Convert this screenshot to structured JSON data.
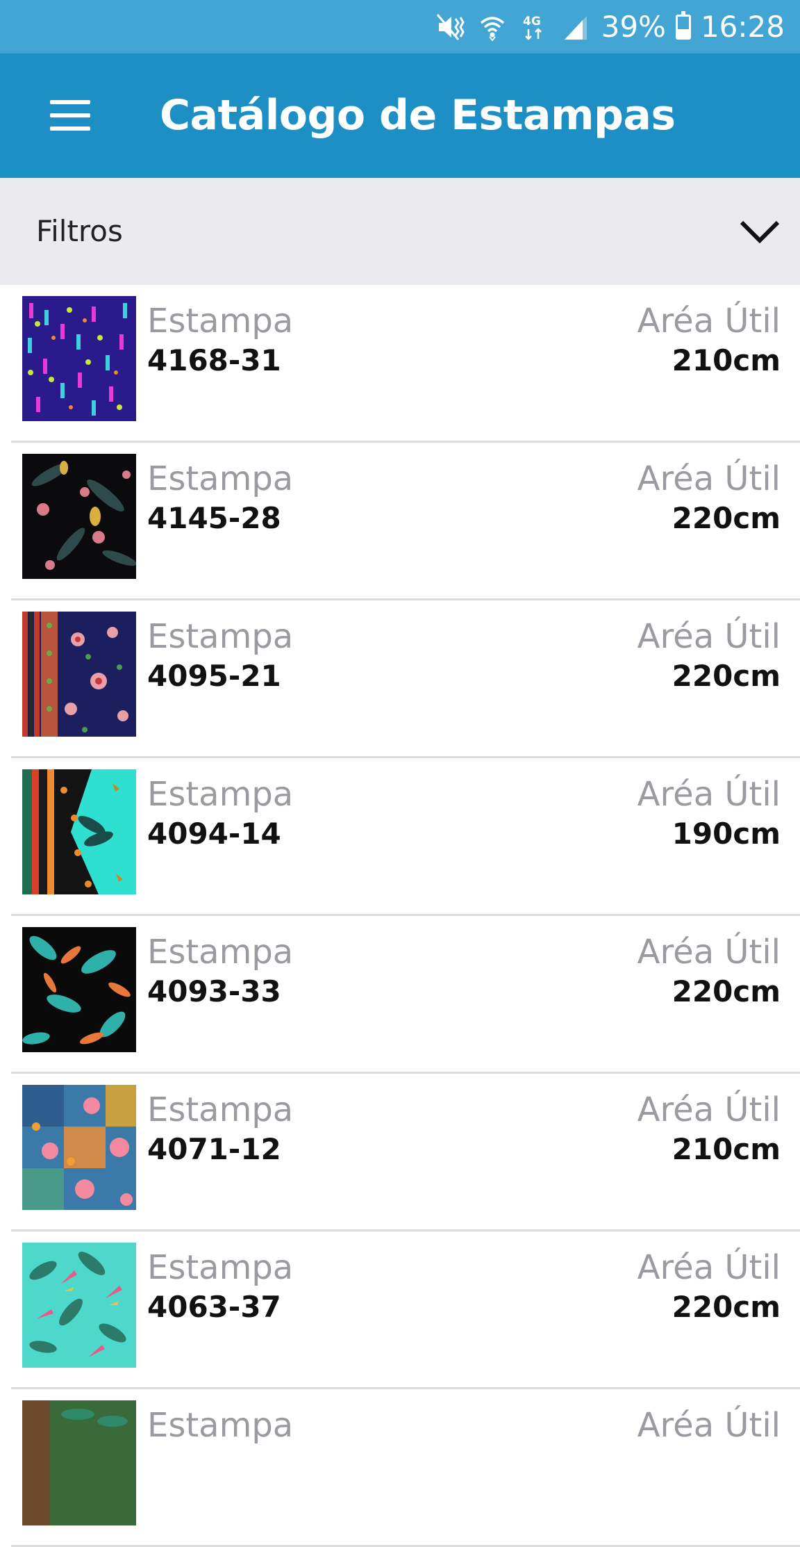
{
  "status_bar": {
    "icons": [
      "mute-vibrate-icon",
      "wifi-icon",
      "4g-icon",
      "signal-icon",
      "battery-icon"
    ],
    "network": "4G",
    "battery": "39%",
    "battery_level": 0.39,
    "time": "16:28"
  },
  "app_bar": {
    "title": "Catálogo de Estampas",
    "menu_icon": "hamburger-menu-icon",
    "color": "#1e8fc4"
  },
  "filters": {
    "label": "Filtros",
    "icon": "chevron-down-icon"
  },
  "list": {
    "items": [
      {
        "label": "Estampa",
        "code": "4168-31",
        "area_label": "Aréa Útil",
        "area": "210cm"
      },
      {
        "label": "Estampa",
        "code": "4145-28",
        "area_label": "Aréa Útil",
        "area": "220cm"
      },
      {
        "label": "Estampa",
        "code": "4095-21",
        "area_label": "Aréa Útil",
        "area": "220cm"
      },
      {
        "label": "Estampa",
        "code": "4094-14",
        "area_label": "Aréa Útil",
        "area": "190cm"
      },
      {
        "label": "Estampa",
        "code": "4093-33",
        "area_label": "Aréa Útil",
        "area": "220cm"
      },
      {
        "label": "Estampa",
        "code": "4071-12",
        "area_label": "Aréa Útil",
        "area": "210cm"
      },
      {
        "label": "Estampa",
        "code": "4063-37",
        "area_label": "Aréa Útil",
        "area": "220cm"
      },
      {
        "label": "Estampa",
        "code": "",
        "area_label": "Aréa Útil",
        "area": ""
      }
    ]
  }
}
